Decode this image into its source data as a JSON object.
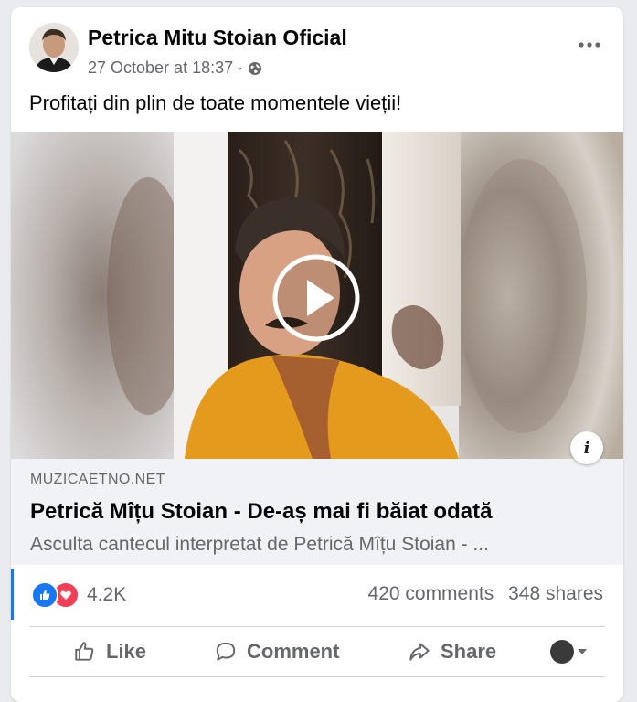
{
  "post": {
    "page_name": "Petrica Mitu Stoian Oficial",
    "timestamp": "27 October at 18:37",
    "separator": "·",
    "privacy_icon": "globe-icon",
    "caption": "Profitați din plin de toate momentele vieții!"
  },
  "media": {
    "type": "video",
    "play_icon": "play-icon"
  },
  "link": {
    "domain": "MUZICAETNO.NET",
    "title": "Petrică Mîțu Stoian - De-aș mai fi băiat odată",
    "description": "Asculta cantecul interpretat de Petrică Mîțu Stoian - ...",
    "info_icon": "info-icon",
    "info_glyph": "i"
  },
  "stats": {
    "reaction_icons": [
      "like-icon",
      "love-icon"
    ],
    "reaction_count": "4.2K",
    "comments": "420 comments",
    "shares": "348 shares"
  },
  "actions": {
    "like": "Like",
    "comment": "Comment",
    "share": "Share"
  },
  "colors": {
    "facebook_blue": "#1877f2",
    "love_red": "#f33e58",
    "secondary_text": "#65676b",
    "shirt_orange": "#e49a1c"
  }
}
